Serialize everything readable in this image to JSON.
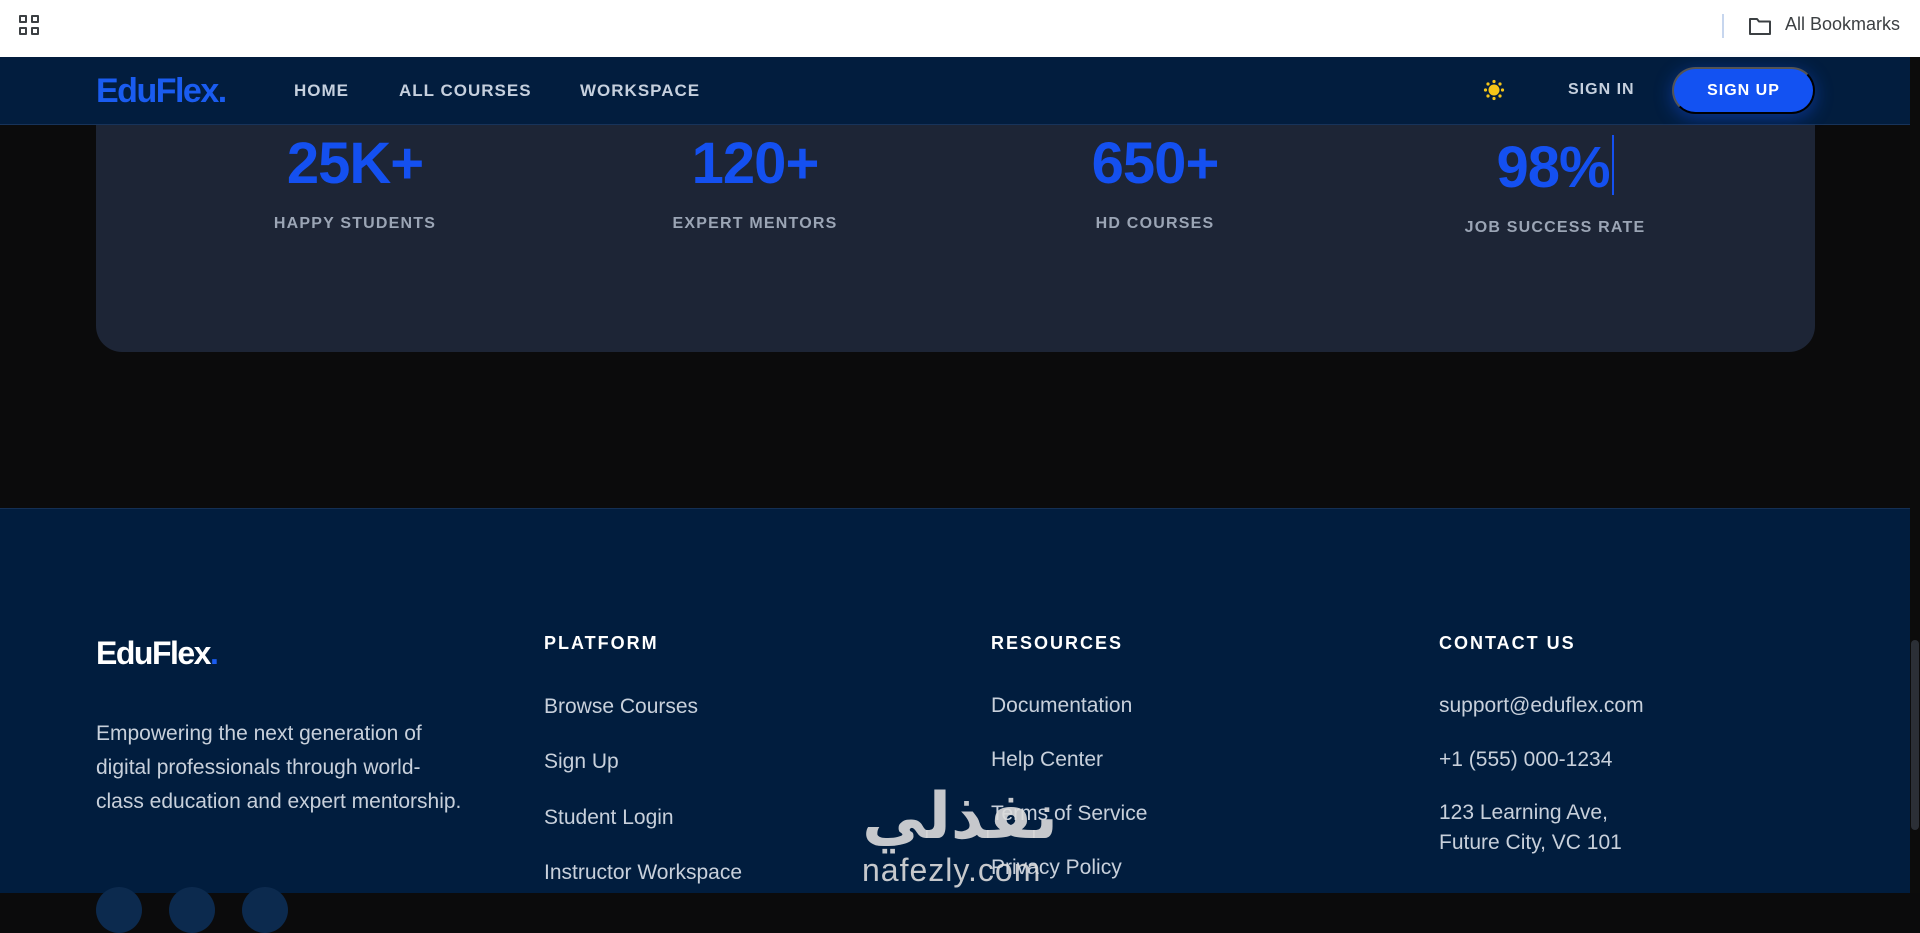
{
  "bookmarks_bar": {
    "apps_icon": "apps-grid-icon",
    "folder_icon": "folder-icon",
    "all_bookmarks_label": "All Bookmarks"
  },
  "navbar": {
    "logo_text": "EduFlex",
    "logo_dot": ".",
    "links": [
      "HOME",
      "ALL COURSES",
      "WORKSPACE"
    ],
    "theme_icon": "sun-icon",
    "sign_in": "SIGN IN",
    "sign_up": "SIGN UP"
  },
  "stats": [
    {
      "value": "25K+",
      "label": "HAPPY STUDENTS"
    },
    {
      "value": "120+",
      "label": "EXPERT MENTORS"
    },
    {
      "value": "650+",
      "label": "HD COURSES"
    },
    {
      "value": "98%",
      "label": "JOB SUCCESS RATE"
    }
  ],
  "footer": {
    "logo_text": "EduFlex",
    "logo_dot": ".",
    "description": "Empowering the next generation of digital professionals through world-class education and expert mentorship.",
    "platform": {
      "title": "PLATFORM",
      "links": [
        "Browse Courses",
        "Sign Up",
        "Student Login",
        "Instructor Workspace"
      ]
    },
    "resources": {
      "title": "RESOURCES",
      "links": [
        "Documentation",
        "Help Center",
        "Terms of Service",
        "Privacy Policy"
      ]
    },
    "contact": {
      "title": "CONTACT US",
      "email": "support@eduflex.com",
      "phone": "+1 (555) 000-1234",
      "address_line1": "123 Learning Ave,",
      "address_line2": "Future City, VC 101"
    }
  },
  "watermark": {
    "arabic": "نفذلي",
    "latin": "nafezly.com"
  },
  "colors": {
    "accent": "#1352f2",
    "nav_bg": "#021d3e",
    "card_bg": "#1d2536",
    "footer_bg": "#011d3e",
    "theme_icon": "#f5c518"
  }
}
